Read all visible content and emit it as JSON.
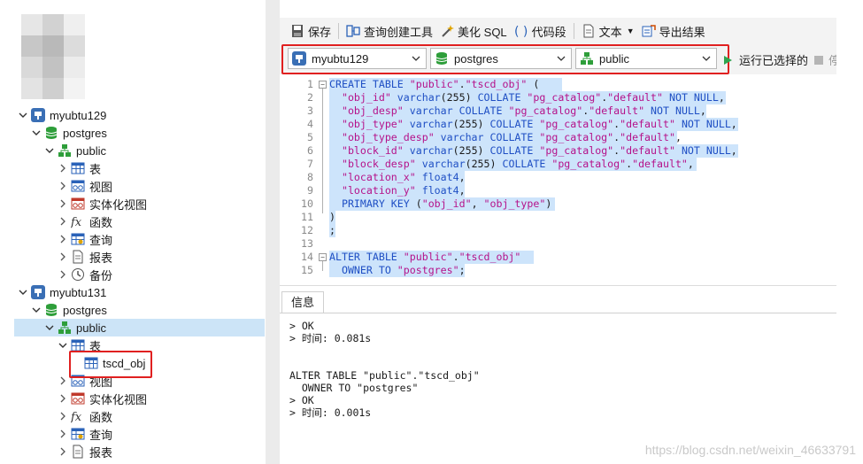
{
  "tree": {
    "rows": [
      {
        "label": "myubtu129",
        "icon": "pg-server-icon",
        "toggle": "expanded"
      },
      {
        "label": "postgres",
        "icon": "database-icon",
        "toggle": "expanded"
      },
      {
        "label": "public",
        "icon": "schema-icon",
        "toggle": "expanded"
      },
      {
        "label": "表",
        "icon": "table-icon",
        "toggle": "collapsed"
      },
      {
        "label": "视图",
        "icon": "view-icon",
        "toggle": "collapsed"
      },
      {
        "label": "实体化视图",
        "icon": "materialized-view-icon",
        "toggle": "collapsed"
      },
      {
        "label": "函数",
        "icon": "function-icon",
        "toggle": "collapsed"
      },
      {
        "label": "查询",
        "icon": "query-icon",
        "toggle": "collapsed"
      },
      {
        "label": "报表",
        "icon": "report-icon",
        "toggle": "collapsed"
      },
      {
        "label": "备份",
        "icon": "backup-icon",
        "toggle": "collapsed"
      },
      {
        "label": "myubtu131",
        "icon": "pg-server-icon",
        "toggle": "expanded"
      },
      {
        "label": "postgres",
        "icon": "database-icon",
        "toggle": "expanded"
      },
      {
        "label": "public",
        "icon": "schema-icon",
        "toggle": "expanded"
      },
      {
        "label": "表",
        "icon": "table-icon",
        "toggle": "expanded"
      },
      {
        "label": "tscd_obj",
        "icon": "table-icon",
        "toggle": "none"
      },
      {
        "label": "视图",
        "icon": "view-icon",
        "toggle": "collapsed"
      },
      {
        "label": "实体化视图",
        "icon": "materialized-view-icon",
        "toggle": "collapsed"
      },
      {
        "label": "函数",
        "icon": "function-icon",
        "toggle": "collapsed"
      },
      {
        "label": "查询",
        "icon": "query-icon",
        "toggle": "collapsed"
      },
      {
        "label": "报表",
        "icon": "report-icon",
        "toggle": "collapsed"
      }
    ]
  },
  "toolbar": {
    "save": "保存",
    "query_builder": "查询创建工具",
    "beautify": "美化 SQL",
    "snippet": "代码段",
    "text": "文本",
    "export": "导出结果"
  },
  "selectors": {
    "connection": "myubtu129",
    "database": "postgres",
    "schema": "public",
    "run_selected": "运行已选择的",
    "stop": "停"
  },
  "editor": {
    "lines": [
      {
        "n": "1",
        "html": "<span class=\"kw\">CREATE TABLE</span> <span class=\"str\">\"public\"</span>.<span class=\"str\">\"tscd_obj\"</span> ("
      },
      {
        "n": "2",
        "html": "  <span class=\"str\">\"obj_id\"</span> <span class=\"fn\">varchar</span>(255) <span class=\"kw\">COLLATE</span> <span class=\"str\">\"pg_catalog\"</span>.<span class=\"str\">\"default\"</span> <span class=\"kw\">NOT NULL</span>,"
      },
      {
        "n": "3",
        "html": "  <span class=\"str\">\"obj_desp\"</span> <span class=\"fn\">varchar</span> <span class=\"kw\">COLLATE</span> <span class=\"str\">\"pg_catalog\"</span>.<span class=\"str\">\"default\"</span> <span class=\"kw\">NOT NULL</span>,"
      },
      {
        "n": "4",
        "html": "  <span class=\"str\">\"obj_type\"</span> <span class=\"fn\">varchar</span>(255) <span class=\"kw\">COLLATE</span> <span class=\"str\">\"pg_catalog\"</span>.<span class=\"str\">\"default\"</span> <span class=\"kw\">NOT NULL</span>,"
      },
      {
        "n": "5",
        "html": "  <span class=\"str\">\"obj_type_desp\"</span> <span class=\"fn\">varchar</span> <span class=\"kw\">COLLATE</span> <span class=\"str\">\"pg_catalog\"</span>.<span class=\"str\">\"default\"</span>,"
      },
      {
        "n": "6",
        "html": "  <span class=\"str\">\"block_id\"</span> <span class=\"fn\">varchar</span>(255) <span class=\"kw\">COLLATE</span> <span class=\"str\">\"pg_catalog\"</span>.<span class=\"str\">\"default\"</span> <span class=\"kw\">NOT NULL</span>,"
      },
      {
        "n": "7",
        "html": "  <span class=\"str\">\"block_desp\"</span> <span class=\"fn\">varchar</span>(255) <span class=\"kw\">COLLATE</span> <span class=\"str\">\"pg_catalog\"</span>.<span class=\"str\">\"default\"</span>,"
      },
      {
        "n": "8",
        "html": "  <span class=\"str\">\"location_x\"</span> <span class=\"fn\">float4</span>,"
      },
      {
        "n": "9",
        "html": "  <span class=\"str\">\"location_y\"</span> <span class=\"fn\">float4</span>,"
      },
      {
        "n": "10",
        "html": "  <span class=\"kw\">PRIMARY KEY</span> (<span class=\"str\">\"obj_id\"</span>, <span class=\"str\">\"obj_type\"</span>)"
      },
      {
        "n": "11",
        "html": ")"
      },
      {
        "n": "12",
        "html": ";"
      },
      {
        "n": "13",
        "html": ""
      },
      {
        "n": "14",
        "html": "<span class=\"kw\">ALTER TABLE</span> <span class=\"str\">\"public\"</span>.<span class=\"str\">\"tscd_obj\"</span> "
      },
      {
        "n": "15",
        "html": "  <span class=\"kw\">OWNER TO</span> <span class=\"str\">\"postgres\"</span>;"
      }
    ]
  },
  "info": {
    "tab": "信息",
    "messages": [
      "> OK",
      "> 时间: 0.081s",
      "",
      "",
      "ALTER TABLE \"public\".\"tscd_obj\"",
      "  OWNER TO \"postgres\"",
      "> OK",
      "> 时间: 0.001s"
    ]
  },
  "watermark": "https://blog.csdn.net/weixin_46633791",
  "colors": {
    "accent": "#1f4fc4",
    "string": "#b5128a",
    "highlight": "#cde4fb",
    "red_box": "#e02020",
    "run_green": "#2ea44f"
  }
}
